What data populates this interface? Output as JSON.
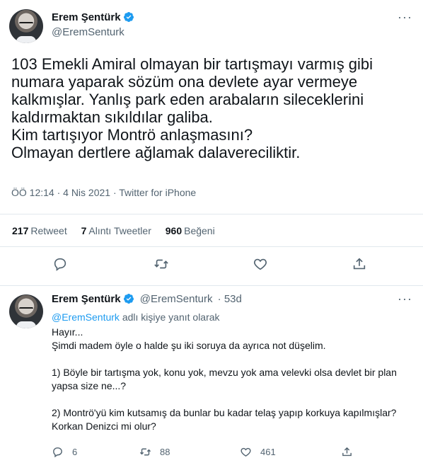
{
  "main": {
    "author_name": "Erem Şentürk",
    "author_handle": "@EremSenturk",
    "text": "103 Emekli Amiral olmayan bir tartışmayı varmış gibi numara yaparak sözüm ona devlete ayar vermeye kalkmışlar. Yanlış park eden arabaların sileceklerini kaldırmaktan sıkıldılar galiba.\nKim tartışıyor Montrö anlaşmasını?\nOlmayan dertlere ağlamak dalavereciliktir.",
    "meta": "ÖÖ 12:14 · 4 Nis 2021 · Twitter for iPhone",
    "stats": {
      "retweets_count": "217",
      "retweets_label": "Retweet",
      "quotes_count": "7",
      "quotes_label": "Alıntı Tweetler",
      "likes_count": "960",
      "likes_label": "Beğeni"
    },
    "icons": [
      "reply-icon",
      "retweet-icon",
      "like-icon",
      "share-icon"
    ]
  },
  "reply": {
    "author_name": "Erem Şentürk",
    "author_handle": "@EremSenturk",
    "time": "· 53d",
    "reply_to_mention": "@EremSenturk",
    "reply_to_suffix": "adlı kişiye yanıt olarak",
    "text": "Hayır...\nŞimdi madem öyle o halde şu iki soruya da ayrıca not düşelim.\n\n1) Böyle bir tartışma yok, konu yok, mevzu yok ama velevki olsa devlet bir plan yapsa size ne...?\n\n2) Montrö'yü kim kutsamış da bunlar bu kadar telaş yapıp korkuya kapılmışlar? Korkan Denizci mi olur?",
    "replies_count": "6",
    "retweets_count": "88",
    "likes_count": "461"
  },
  "colors": {
    "accent": "#1d9bf0",
    "secondary_text": "#536471",
    "divider": "#e1e8ed"
  }
}
